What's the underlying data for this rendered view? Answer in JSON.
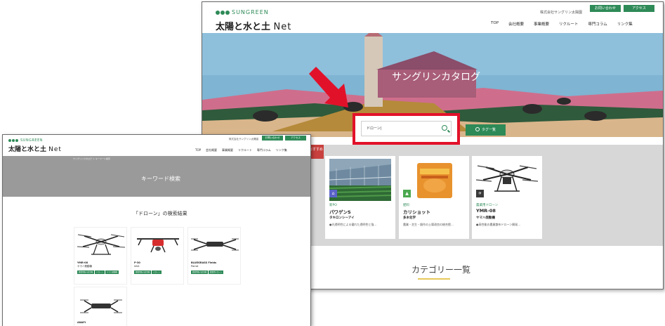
{
  "back_window": {
    "brand_logo": "SUNGREEN",
    "site_title": "太陽と水と土",
    "site_title_suffix": "Net",
    "corp_name": "株式会社サングリン太陽園",
    "top_buttons": [
      "お問い合わせ",
      "アクセス"
    ],
    "nav": [
      "TOP",
      "会社概要",
      "事業概要",
      "リクルート",
      "専門コラム",
      "リンク集"
    ],
    "hero_text": "サングリンカタログ",
    "search": {
      "value": "ドローン|"
    },
    "tag_button": "タグ一覧",
    "ribbon": "おすすめ",
    "products": [
      {
        "badge_color": "#5b63c9",
        "category": "新PO",
        "name": "パワゲンS",
        "maker": "タキロンシーアイ",
        "desc": "●光透明性による優れた透明性と強..."
      },
      {
        "badge_color": "#4aa84e",
        "category": "肥料",
        "name": "カリショット",
        "maker": "多木化学",
        "desc": "農業・芝生・畑作の土壌改良の総合肥..."
      },
      {
        "badge_color": "#3a3a3a",
        "category": "農業用ドローン",
        "name": "YMR-08",
        "maker": "ヤマハ発動機",
        "desc": "●高性能の農業散布ドローン開発..."
      }
    ],
    "category_title": "カテゴリー一覧"
  },
  "front_window": {
    "brand_logo": "SUNGREEN",
    "site_title": "太陽と水と土",
    "site_title_suffix": "Net",
    "corp_name": "株式会社サングリン太陽園",
    "top_buttons": [
      "お問い合わせ",
      "アクセス"
    ],
    "nav": [
      "TOP",
      "会社概要",
      "事業概要",
      "リクルート",
      "専門コラム",
      "リンク集"
    ],
    "breadcrumb": "サングリンカタログ ＞ キーワード検索",
    "hero_title": "キーワード検索",
    "result_title": "「ドローン」の検索結果",
    "results": [
      {
        "name": "YMR-08",
        "maker": "ヤマハ発動機",
        "tags": [
          "農業用無人航空機",
          "ドローン",
          "ヤマハ発動機"
        ]
      },
      {
        "name": "P-30",
        "maker": "XAG",
        "tags": [
          "農業用無人航空機",
          "ドローン"
        ]
      },
      {
        "name": "BLUEGRASS Fields",
        "maker": "Parrot",
        "tags": [
          "農業用無人航空機",
          "農業用ドローン"
        ]
      },
      {
        "name": "ANAFI",
        "maker": "",
        "tags": []
      }
    ]
  },
  "colors": {
    "brand_green": "#2e8a57",
    "highlight_red": "#e2112a",
    "ribbon_red": "#c8413e"
  }
}
